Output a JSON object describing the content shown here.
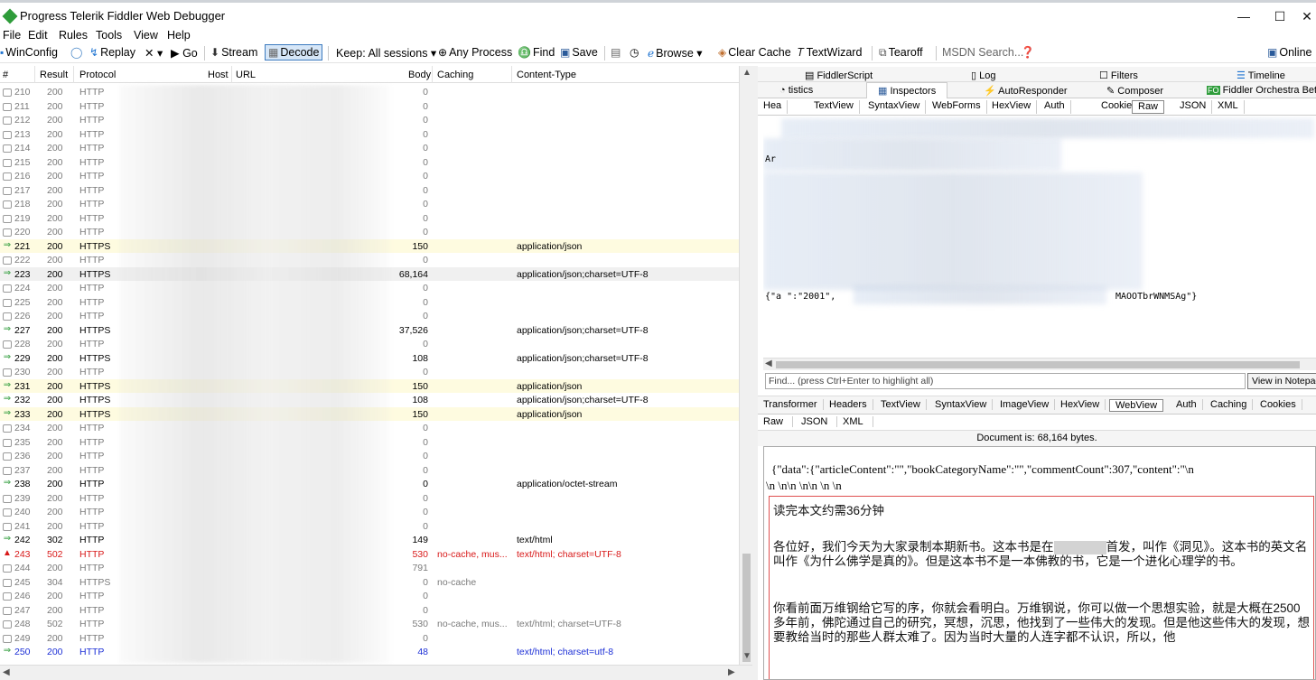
{
  "window": {
    "title": "Progress Telerik Fiddler Web Debugger",
    "minimize": "—",
    "maximize": "☐",
    "close": "✕"
  },
  "menu": [
    "File",
    "Edit",
    "Rules",
    "Tools",
    "View",
    "Help"
  ],
  "toolbar": {
    "winconfig": "WinConfig",
    "replay": "Replay",
    "remove": "✕ ▾",
    "go": "▶ Go",
    "stream": "Stream",
    "decode": "Decode",
    "keep": "Keep: All sessions ▾",
    "process": "Any Process",
    "find": "Find",
    "save": "Save",
    "browse": "Browse ▾",
    "clear_cache": "Clear Cache",
    "textwizard": "TextWizard",
    "tearoff": "Tearoff",
    "msdn": "MSDN Search...",
    "online": "Online"
  },
  "columns": {
    "num": "#",
    "result": "Result",
    "protocol": "Protocol",
    "host": "Host",
    "url": "URL",
    "body": "Body",
    "caching": "Caching",
    "content_type": "Content-Type"
  },
  "sessions": [
    {
      "num": "210",
      "result": "200",
      "protocol": "HTTP",
      "body": "0",
      "caching": "",
      "ctype": "",
      "style": "gray"
    },
    {
      "num": "211",
      "result": "200",
      "protocol": "HTTP",
      "body": "0",
      "caching": "",
      "ctype": "",
      "style": "gray"
    },
    {
      "num": "212",
      "result": "200",
      "protocol": "HTTP",
      "body": "0",
      "caching": "",
      "ctype": "",
      "style": "gray"
    },
    {
      "num": "213",
      "result": "200",
      "protocol": "HTTP",
      "body": "0",
      "caching": "",
      "ctype": "",
      "style": "gray"
    },
    {
      "num": "214",
      "result": "200",
      "protocol": "HTTP",
      "body": "0",
      "caching": "",
      "ctype": "",
      "style": "gray"
    },
    {
      "num": "215",
      "result": "200",
      "protocol": "HTTP",
      "body": "0",
      "caching": "",
      "ctype": "",
      "style": "gray"
    },
    {
      "num": "216",
      "result": "200",
      "protocol": "HTTP",
      "body": "0",
      "caching": "",
      "ctype": "",
      "style": "gray"
    },
    {
      "num": "217",
      "result": "200",
      "protocol": "HTTP",
      "body": "0",
      "caching": "",
      "ctype": "",
      "style": "gray"
    },
    {
      "num": "218",
      "result": "200",
      "protocol": "HTTP",
      "body": "0",
      "caching": "",
      "ctype": "",
      "style": "gray"
    },
    {
      "num": "219",
      "result": "200",
      "protocol": "HTTP",
      "body": "0",
      "caching": "",
      "ctype": "",
      "style": "gray"
    },
    {
      "num": "220",
      "result": "200",
      "protocol": "HTTP",
      "body": "0",
      "caching": "",
      "ctype": "",
      "style": "gray"
    },
    {
      "num": "221",
      "result": "200",
      "protocol": "HTTPS",
      "body": "150",
      "caching": "",
      "ctype": "application/json",
      "style": "yellow"
    },
    {
      "num": "222",
      "result": "200",
      "protocol": "HTTP",
      "body": "0",
      "caching": "",
      "ctype": "",
      "style": "gray"
    },
    {
      "num": "223",
      "result": "200",
      "protocol": "HTTPS",
      "body": "68,164",
      "caching": "",
      "ctype": "application/json;charset=UTF-8",
      "style": "selected"
    },
    {
      "num": "224",
      "result": "200",
      "protocol": "HTTP",
      "body": "0",
      "caching": "",
      "ctype": "",
      "style": "gray"
    },
    {
      "num": "225",
      "result": "200",
      "protocol": "HTTP",
      "body": "0",
      "caching": "",
      "ctype": "",
      "style": "gray"
    },
    {
      "num": "226",
      "result": "200",
      "protocol": "HTTP",
      "body": "0",
      "caching": "",
      "ctype": "",
      "style": "gray"
    },
    {
      "num": "227",
      "result": "200",
      "protocol": "HTTPS",
      "body": "37,526",
      "caching": "",
      "ctype": "application/json;charset=UTF-8",
      "style": "normal"
    },
    {
      "num": "228",
      "result": "200",
      "protocol": "HTTP",
      "body": "0",
      "caching": "",
      "ctype": "",
      "style": "gray"
    },
    {
      "num": "229",
      "result": "200",
      "protocol": "HTTPS",
      "body": "108",
      "caching": "",
      "ctype": "application/json;charset=UTF-8",
      "style": "normal"
    },
    {
      "num": "230",
      "result": "200",
      "protocol": "HTTP",
      "body": "0",
      "caching": "",
      "ctype": "",
      "style": "gray"
    },
    {
      "num": "231",
      "result": "200",
      "protocol": "HTTPS",
      "body": "150",
      "caching": "",
      "ctype": "application/json",
      "style": "yellow"
    },
    {
      "num": "232",
      "result": "200",
      "protocol": "HTTPS",
      "body": "108",
      "caching": "",
      "ctype": "application/json;charset=UTF-8",
      "style": "normal"
    },
    {
      "num": "233",
      "result": "200",
      "protocol": "HTTPS",
      "body": "150",
      "caching": "",
      "ctype": "application/json",
      "style": "yellow"
    },
    {
      "num": "234",
      "result": "200",
      "protocol": "HTTP",
      "body": "0",
      "caching": "",
      "ctype": "",
      "style": "gray"
    },
    {
      "num": "235",
      "result": "200",
      "protocol": "HTTP",
      "body": "0",
      "caching": "",
      "ctype": "",
      "style": "gray"
    },
    {
      "num": "236",
      "result": "200",
      "protocol": "HTTP",
      "body": "0",
      "caching": "",
      "ctype": "",
      "style": "gray"
    },
    {
      "num": "237",
      "result": "200",
      "protocol": "HTTP",
      "body": "0",
      "caching": "",
      "ctype": "",
      "style": "gray"
    },
    {
      "num": "238",
      "result": "200",
      "protocol": "HTTP",
      "body": "0",
      "caching": "",
      "ctype": "application/octet-stream",
      "style": "normal"
    },
    {
      "num": "239",
      "result": "200",
      "protocol": "HTTP",
      "body": "0",
      "caching": "",
      "ctype": "",
      "style": "gray"
    },
    {
      "num": "240",
      "result": "200",
      "protocol": "HTTP",
      "body": "0",
      "caching": "",
      "ctype": "",
      "style": "gray"
    },
    {
      "num": "241",
      "result": "200",
      "protocol": "HTTP",
      "body": "0",
      "caching": "",
      "ctype": "",
      "style": "gray"
    },
    {
      "num": "242",
      "result": "302",
      "protocol": "HTTP",
      "body": "149",
      "caching": "",
      "ctype": "text/html",
      "style": "normal"
    },
    {
      "num": "243",
      "result": "502",
      "protocol": "HTTP",
      "body": "530",
      "caching": "no-cache, mus...",
      "ctype": "text/html; charset=UTF-8",
      "style": "red"
    },
    {
      "num": "244",
      "result": "200",
      "protocol": "HTTP",
      "body": "791",
      "caching": "",
      "ctype": "",
      "style": "gray"
    },
    {
      "num": "245",
      "result": "304",
      "protocol": "HTTPS",
      "body": "0",
      "caching": "no-cache",
      "ctype": "",
      "style": "gray"
    },
    {
      "num": "246",
      "result": "200",
      "protocol": "HTTP",
      "body": "0",
      "caching": "",
      "ctype": "",
      "style": "gray"
    },
    {
      "num": "247",
      "result": "200",
      "protocol": "HTTP",
      "body": "0",
      "caching": "",
      "ctype": "",
      "style": "gray"
    },
    {
      "num": "248",
      "result": "502",
      "protocol": "HTTP",
      "body": "530",
      "caching": "no-cache, mus...",
      "ctype": "text/html; charset=UTF-8",
      "style": "gray"
    },
    {
      "num": "249",
      "result": "200",
      "protocol": "HTTP",
      "body": "0",
      "caching": "",
      "ctype": "",
      "style": "gray"
    },
    {
      "num": "250",
      "result": "200",
      "protocol": "HTTP",
      "body": "48",
      "caching": "",
      "ctype": "text/html; charset=utf-8",
      "style": "blue"
    }
  ],
  "right_tabs_row1": [
    "FiddlerScript",
    "Log",
    "Filters",
    "Timeline"
  ],
  "right_tabs_row2": [
    "tistics",
    "Inspectors",
    "AutoResponder",
    "Composer",
    "Fiddler Orchestra Beta"
  ],
  "request_subtabs": [
    "Hea",
    "TextView",
    "SyntaxView",
    "WebForms",
    "HexView",
    "Auth",
    "Cookies",
    "Raw",
    "JSON",
    "XML"
  ],
  "request_raw": {
    "line1": "Ar",
    "line_json": "{\"a  \":\"2001\",",
    "line_json_tail": "MAOOTbrWNMSAg\"}"
  },
  "find": {
    "placeholder": "Find... (press Ctrl+Enter to highlight all)",
    "notepad": "View in Notepad"
  },
  "response_tabs": [
    "Transformer",
    "Headers",
    "TextView",
    "SyntaxView",
    "ImageView",
    "HexView",
    "WebView",
    "Auth",
    "Caching",
    "Cookies"
  ],
  "response_tabs2": [
    "Raw",
    "JSON",
    "XML"
  ],
  "doc_info": "Document is: 68,164 bytes.",
  "webview": {
    "json_line1": "{\"data\":{\"articleContent\":\"\",\"bookCategoryName\":\"\",\"commentCount\":307,\"content\":\"\\n",
    "json_line2": "\\n \\n\\n \\n\\n \\n \\n",
    "reading_time": "读完本文约需36分钟",
    "para1_a": "各位好，我们今天为大家录制本期新书。这本书是在",
    "para1_b": "首发，叫作《洞见》。这本书的英文名叫作《为什么佛学是真的》。但是这本书不是一本佛教的书，它是一个进化心理学的书。",
    "para2": "你看前面万维钢给它写的序，你就会看明白。万维钢说，你可以做一个思想实验，就是大概在2500多年前，佛陀通过自己的研究，冥想，沉思，他找到了一些伟大的发现。但是他这些伟大的发现，想要教给当时的那些人群太难了。因为当时大量的人连字都不认识，所以，他"
  }
}
